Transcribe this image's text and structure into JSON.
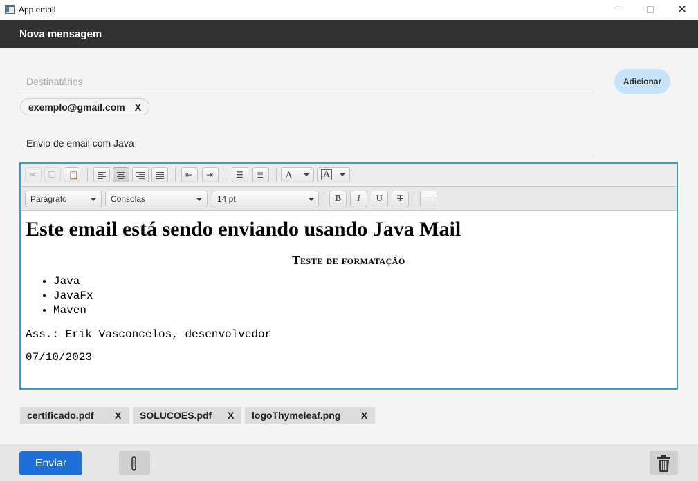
{
  "window": {
    "title": "App email",
    "minimize_icon": "minimize-icon",
    "maximize_icon": "maximize-icon",
    "close_label": "✕"
  },
  "header": {
    "title": "Nova mensagem"
  },
  "recipients": {
    "placeholder": "Destinatários",
    "value": "",
    "add_label": "Adicionar",
    "chips": [
      {
        "address": "exemplo@gmail.com",
        "remove": "X"
      }
    ]
  },
  "subject": {
    "value": "Envio de email com Java"
  },
  "toolbar": {
    "paragraph_style": "Parágrafo",
    "font_family": "Consolas",
    "font_size": "14 pt",
    "bold": "B",
    "italic": "I",
    "underline": "U",
    "strike": "T"
  },
  "document": {
    "heading": "Este email está sendo enviando usando Java Mail",
    "subheading": "Teste de formatação",
    "list": [
      "Java",
      "JavaFx",
      "Maven"
    ],
    "signature": "Ass.: Erik Vasconcelos, desenvolvedor",
    "date": "07/10/2023"
  },
  "attachments": [
    {
      "name": "certificado.pdf",
      "remove": "X"
    },
    {
      "name": "SOLUCOES.pdf",
      "remove": "X"
    },
    {
      "name": "logoThymeleaf.png",
      "remove": "X"
    }
  ],
  "footer": {
    "send_label": "Enviar",
    "attach_icon": "paperclip-icon",
    "delete_icon": "trash-icon"
  },
  "colors": {
    "header_bg": "#323232",
    "send_bg": "#1f6fd9",
    "add_bg": "#c8e3f8",
    "editor_border": "#33a0d6"
  }
}
